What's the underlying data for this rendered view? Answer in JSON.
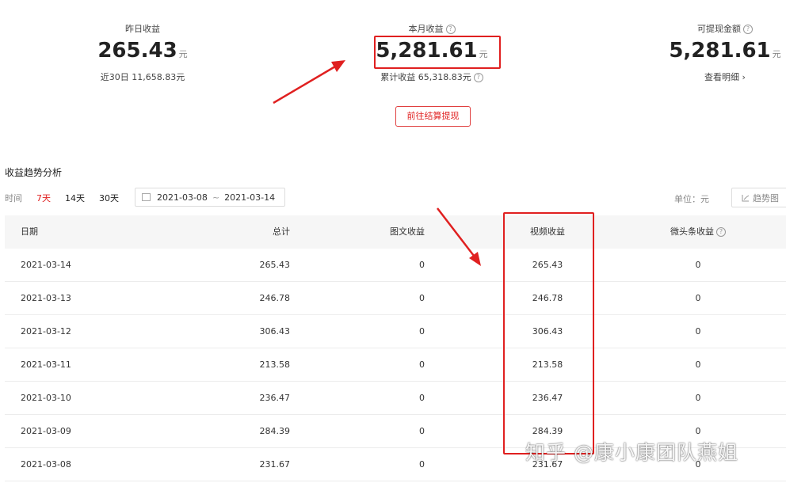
{
  "summary": {
    "yesterday": {
      "label": "昨日收益",
      "value": "265.43",
      "unit": "元",
      "sub": "近30日 11,658.83元"
    },
    "month": {
      "label": "本月收益",
      "value": "5,281.61",
      "unit": "元",
      "sub": "累计收益 65,318.83元"
    },
    "withdrawable": {
      "label": "可提现金额",
      "value": "5,281.61",
      "unit": "元",
      "sub": "查看明细 ›"
    }
  },
  "withdraw_button": "前往结算提现",
  "trend": {
    "title": "收益趋势分析",
    "time_label": "时间",
    "ranges": [
      "7天",
      "14天",
      "30天"
    ],
    "active_range": "7天",
    "date_start": "2021-03-08",
    "date_sep": "~",
    "date_end": "2021-03-14",
    "unit_label": "单位：元",
    "chart_button": "趋势图"
  },
  "table": {
    "headers": {
      "date": "日期",
      "total": "总计",
      "tuwen": "图文收益",
      "video": "视频收益",
      "weitoutiao": "微头条收益"
    },
    "rows": [
      {
        "date": "2021-03-14",
        "total": "265.43",
        "tuwen": "0",
        "video": "265.43",
        "weitoutiao": "0"
      },
      {
        "date": "2021-03-13",
        "total": "246.78",
        "tuwen": "0",
        "video": "246.78",
        "weitoutiao": "0"
      },
      {
        "date": "2021-03-12",
        "total": "306.43",
        "tuwen": "0",
        "video": "306.43",
        "weitoutiao": "0"
      },
      {
        "date": "2021-03-11",
        "total": "213.58",
        "tuwen": "0",
        "video": "213.58",
        "weitoutiao": "0"
      },
      {
        "date": "2021-03-10",
        "total": "236.47",
        "tuwen": "0",
        "video": "236.47",
        "weitoutiao": "0"
      },
      {
        "date": "2021-03-09",
        "total": "284.39",
        "tuwen": "0",
        "video": "284.39",
        "weitoutiao": "0"
      },
      {
        "date": "2021-03-08",
        "total": "231.67",
        "tuwen": "0",
        "video": "231.67",
        "weitoutiao": "0"
      }
    ]
  },
  "watermark": "知乎 @康小康团队燕姐",
  "colors": {
    "accent": "#e02020",
    "annotation": "#e02020"
  },
  "icons": [
    "help-icon",
    "calendar-icon",
    "trend-chart-icon",
    "chevron-right-icon",
    "arrow-annotation"
  ]
}
